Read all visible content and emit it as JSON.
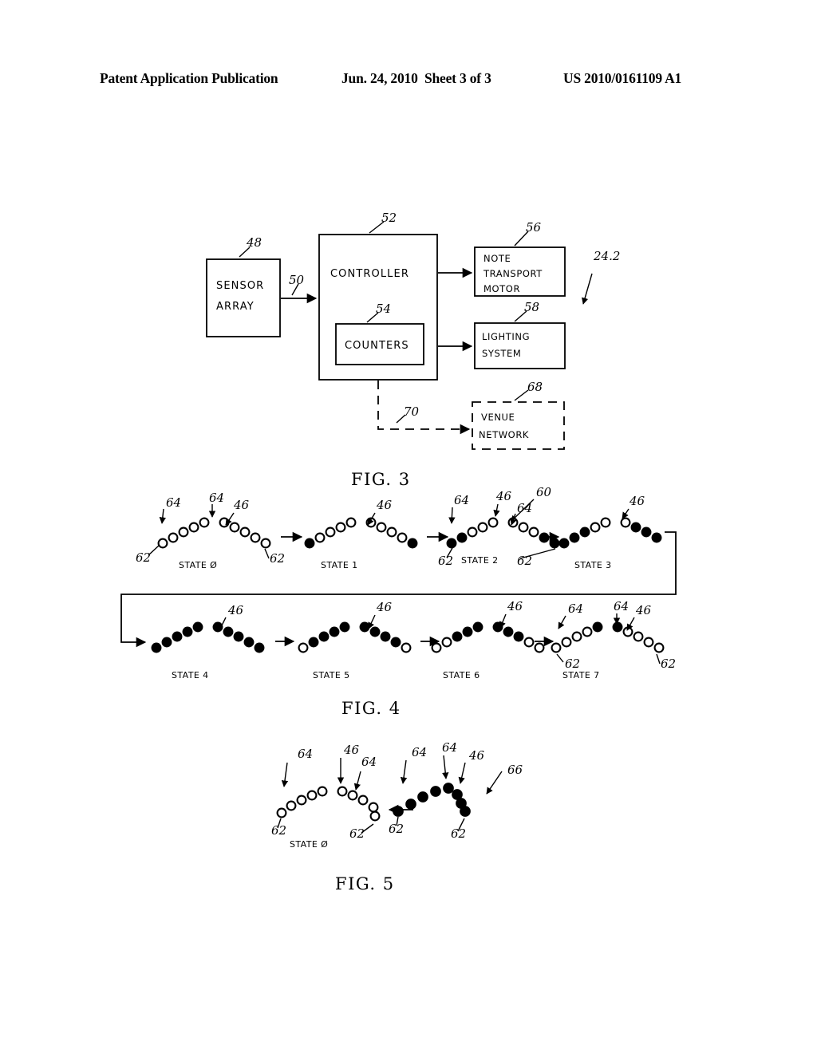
{
  "header": {
    "left": "Patent Application Publication",
    "date": "Jun. 24, 2010",
    "sheet": "Sheet 3 of 3",
    "pubnum": "US 2010/0161109 A1"
  },
  "fig3": {
    "caption": "FIG. 3",
    "system_ref": "24.2",
    "blocks": [
      {
        "id": "sensor-array",
        "label_line1": "SENSOR",
        "label_line2": "ARRAY",
        "ref": "48"
      },
      {
        "id": "controller",
        "label_line1": "CONTROLLER",
        "label_line2": "",
        "ref": "52"
      },
      {
        "id": "counters",
        "label_line1": "COUNTERS",
        "label_line2": "",
        "ref": "54"
      },
      {
        "id": "note-transport-motor",
        "label_line1": "NOTE",
        "label_line2": "TRANSPORT",
        "label_line3": "MOTOR",
        "ref": "56"
      },
      {
        "id": "lighting-system",
        "label_line1": "LIGHTING",
        "label_line2": "SYSTEM",
        "ref": "58"
      },
      {
        "id": "venue-network",
        "label_line1": "VENUE",
        "label_line2": "NETWORK",
        "ref": "68"
      }
    ],
    "connectors": [
      {
        "id": "sensor-to-controller",
        "ref": "50",
        "style": "solid"
      },
      {
        "id": "controller-to-venue-network",
        "ref": "70",
        "style": "dashed"
      }
    ]
  },
  "fig4": {
    "caption": "FIG. 4",
    "group_ref": "60",
    "callouts": {
      "chevron": "46",
      "top_element": "64",
      "bottom_element": "62"
    },
    "states": [
      {
        "label": "STATE Ø",
        "left_arm": [
          0,
          0,
          0,
          0,
          0
        ],
        "right_arm": [
          0,
          0,
          0,
          0,
          0
        ],
        "refs": [
          "64",
          "64",
          "46",
          "62",
          "62"
        ]
      },
      {
        "label": "STATE 1",
        "left_arm": [
          1,
          0,
          0,
          0,
          0
        ],
        "right_arm": [
          0,
          0,
          0,
          0,
          1
        ],
        "refs": [
          "46"
        ]
      },
      {
        "label": "STATE 2",
        "left_arm": [
          1,
          1,
          0,
          0,
          0
        ],
        "right_arm": [
          0,
          0,
          0,
          1,
          1
        ],
        "refs": [
          "64",
          "46",
          "64",
          "62",
          "62"
        ]
      },
      {
        "label": "STATE 3",
        "left_arm": [
          1,
          1,
          1,
          0,
          0
        ],
        "right_arm": [
          0,
          0,
          1,
          1,
          1
        ],
        "refs": [
          "46"
        ]
      },
      {
        "label": "STATE 4",
        "left_arm": [
          1,
          1,
          1,
          1,
          1
        ],
        "right_arm": [
          1,
          1,
          1,
          1,
          1
        ],
        "refs": [
          "46"
        ]
      },
      {
        "label": "STATE 5",
        "left_arm": [
          0,
          1,
          1,
          1,
          1
        ],
        "right_arm": [
          1,
          1,
          1,
          1,
          0
        ],
        "refs": [
          "46"
        ]
      },
      {
        "label": "STATE 6",
        "left_arm": [
          0,
          0,
          1,
          1,
          1
        ],
        "right_arm": [
          1,
          1,
          1,
          0,
          0
        ],
        "refs": [
          "46"
        ]
      },
      {
        "label": "STATE 7",
        "left_arm": [
          0,
          0,
          0,
          0,
          1
        ],
        "right_arm": [
          1,
          0,
          0,
          0,
          0
        ],
        "refs": [
          "64",
          "64",
          "46",
          "62",
          "62"
        ]
      }
    ]
  },
  "fig5": {
    "caption": "FIG. 5",
    "group_ref": "66",
    "states": [
      {
        "label": "STATE Ø",
        "left_arm": [
          0,
          0,
          0,
          0,
          0
        ],
        "right_arm": [
          0,
          0,
          0,
          0,
          0
        ],
        "refs": [
          "64",
          "46",
          "64",
          "62",
          "62"
        ]
      },
      {
        "label": "",
        "left_arm": [
          1,
          1,
          1,
          1
        ],
        "right_arm": [
          1,
          1,
          1,
          1
        ],
        "refs": [
          "64",
          "64",
          "46",
          "62",
          "62"
        ]
      }
    ]
  }
}
